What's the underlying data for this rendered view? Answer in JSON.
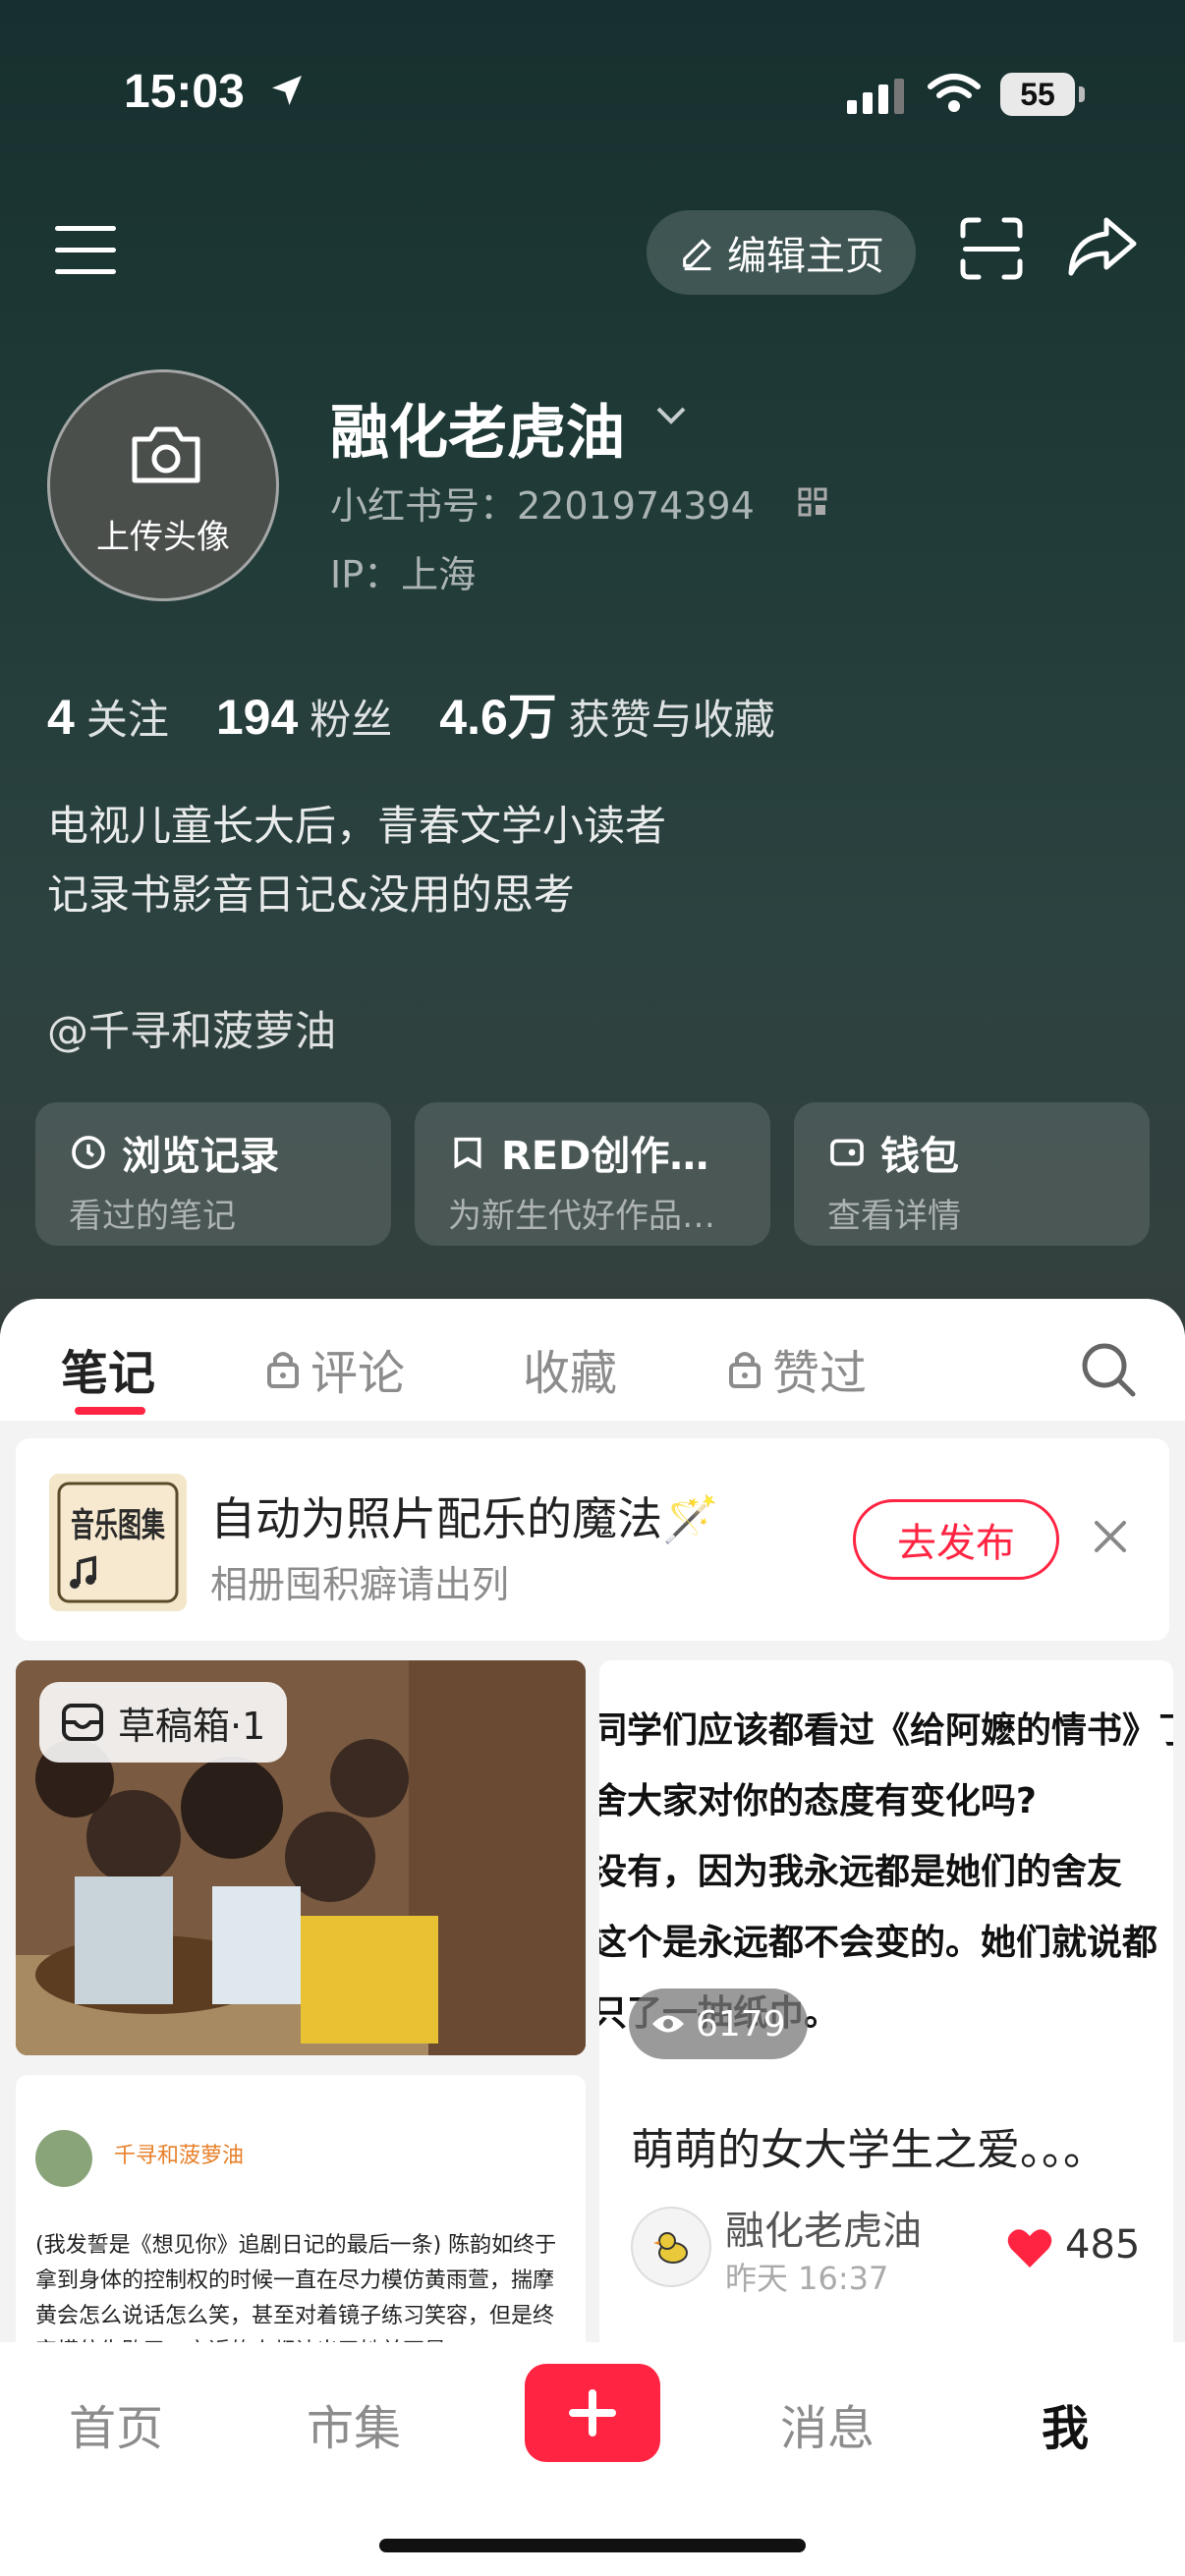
{
  "status": {
    "time": "15:03",
    "battery": "55"
  },
  "header": {
    "edit_label": "编辑主页"
  },
  "profile": {
    "avatar_upload": "上传头像",
    "name": "融化老虎油",
    "red_id": "小红书号：2201974394",
    "ip": "IP：上海"
  },
  "stats": [
    {
      "num": "4",
      "label": "关注"
    },
    {
      "num": "194",
      "label": "粉丝"
    },
    {
      "num": "4.6万",
      "label": "获赞与收藏"
    }
  ],
  "bio": {
    "line1": "电视儿童长大后，青春文学小读者",
    "line2": "记录书影音日记&没用的思考",
    "mention": "@千寻和菠萝油"
  },
  "cards": [
    {
      "title": "浏览记录",
      "sub": "看过的笔记",
      "icon": "clock-icon"
    },
    {
      "title": "RED创作…",
      "sub": "为新生代好作品…",
      "icon": "bookmark-icon"
    },
    {
      "title": "钱包",
      "sub": "查看详情",
      "icon": "wallet-icon"
    }
  ],
  "tabs": [
    {
      "label": "笔记",
      "active": true
    },
    {
      "label": "评论",
      "locked": true
    },
    {
      "label": "收藏"
    },
    {
      "label": "赞过",
      "locked": true
    }
  ],
  "promo": {
    "thumb_text": "音乐图集",
    "title": "自动为照片配乐的魔法🪄",
    "sub": "相册囤积癖请出列",
    "button": "去发布"
  },
  "posts": {
    "left": {
      "badge": "草稿箱·1"
    },
    "right": {
      "lines": [
        "同学们应该都看过《给阿嬷的情书》了",
        "舍大家对你的态度有变化吗?",
        "   没有，因为我永远都是她们的舍友",
        "这个是永远都不会变的。她们就说都",
        "只了一抽纸巾。"
      ],
      "views": "6179",
      "title": "萌萌的女大学生之爱。。。",
      "author": "融化老虎油",
      "time": "昨天 16:37",
      "likes": "485"
    },
    "left2": {
      "name": "千寻和菠萝油",
      "body": "(我发誓是《想见你》追剧日记的最后一条) 陈韵如终于拿到身体的控制权的时候一直在尽力模仿黄雨萱，揣摩黄会怎么说话怎么笑，甚至对着镜子练习笑容，但是终究模仿失败了，亲近的人都认出了她并不是"
    }
  },
  "nav": {
    "home": "首页",
    "market": "市集",
    "messages": "消息",
    "me": "我"
  }
}
